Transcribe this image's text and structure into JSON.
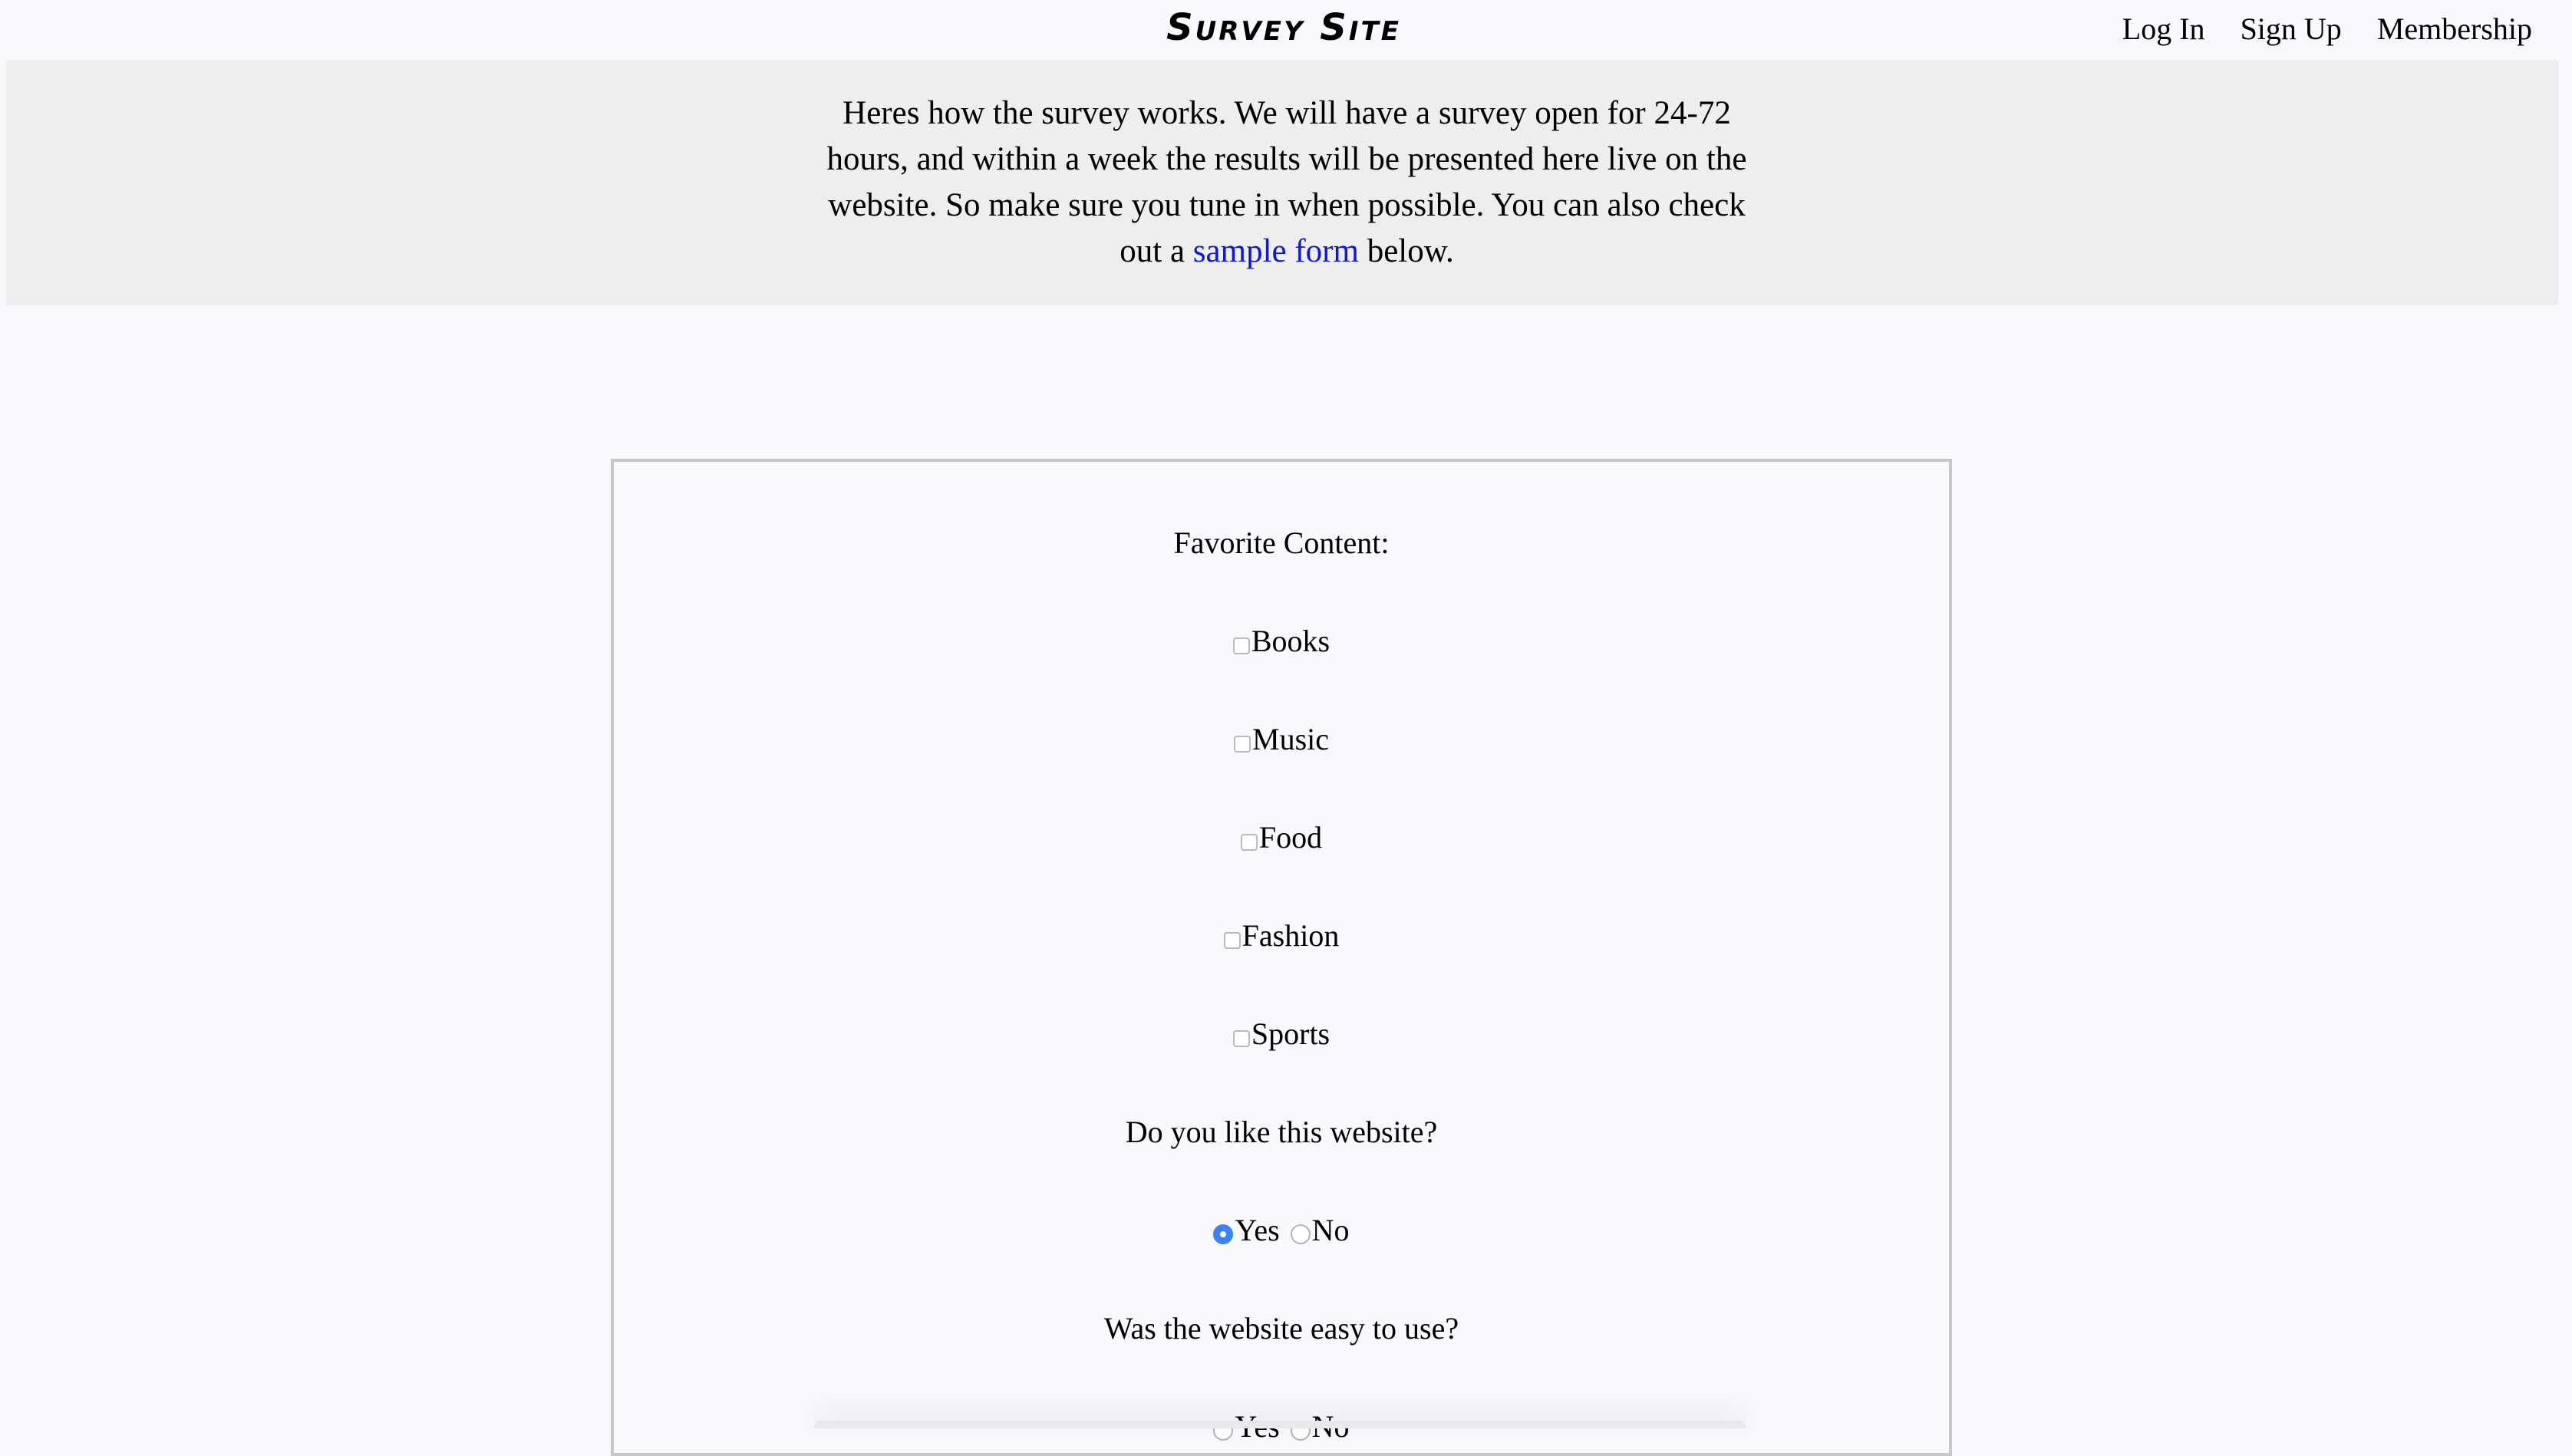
{
  "header": {
    "logo": "Survey Site",
    "nav": [
      "Log In",
      "Sign Up",
      "Membership"
    ]
  },
  "intro": {
    "text_before": "Heres how the survey works. We will have a survey open for 24-72 hours, and within a week the results will be presented here live on the website. So make sure you tune in when possible. You can also check out a ",
    "link": "sample form",
    "text_after": " below."
  },
  "form": {
    "q1": "Favorite Content:",
    "options": [
      "Books",
      "Music",
      "Food",
      "Fashion",
      "Sports"
    ],
    "q2": "Do you like this website?",
    "q2_answers": [
      "Yes",
      "No"
    ],
    "q2_selected": "Yes",
    "q3": "Was the website easy to use?",
    "q3_answers": [
      "Yes",
      "No"
    ]
  },
  "colors": {
    "link": "#0e18d8",
    "radio_selected": "#3b82f6",
    "band": "#eeeeee",
    "page": "#f8f9fd"
  }
}
